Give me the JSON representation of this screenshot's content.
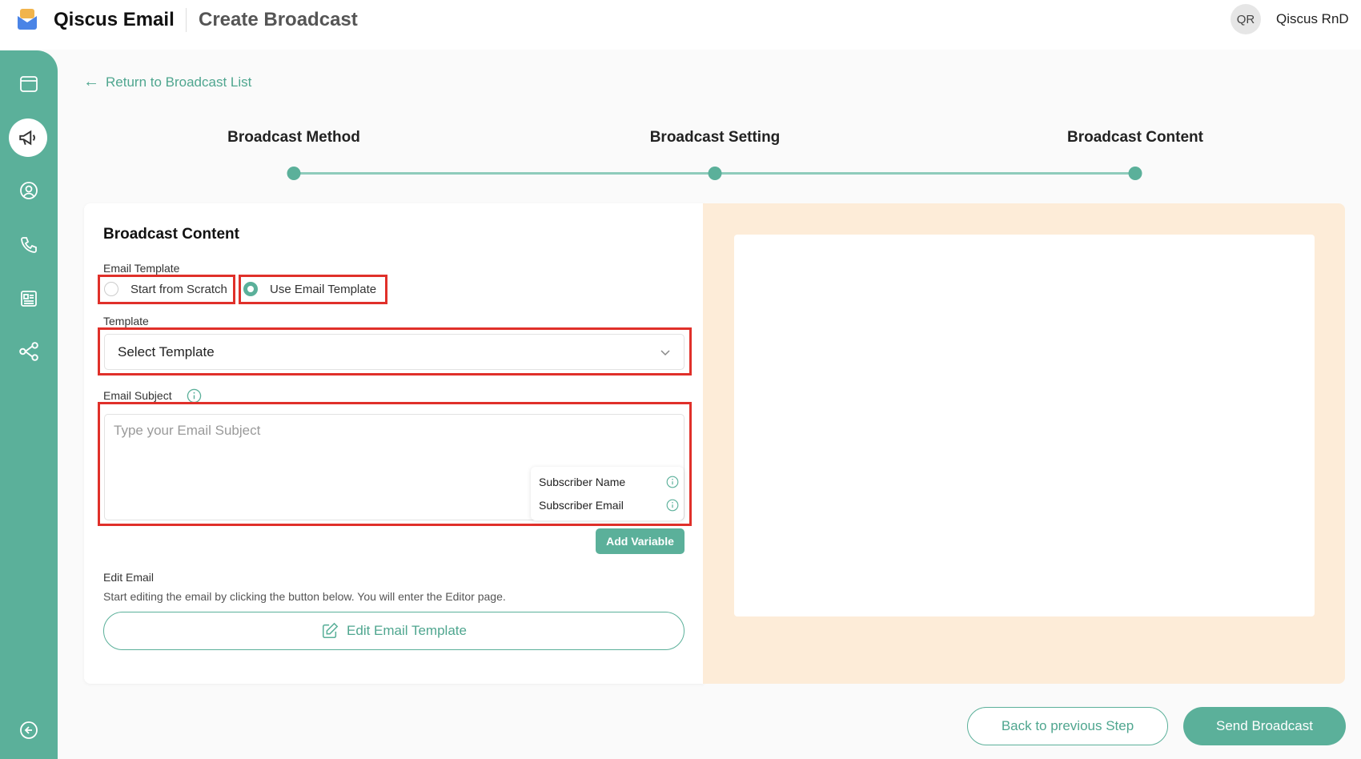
{
  "header": {
    "app_name": "Qiscus Email",
    "page_title": "Create Broadcast",
    "avatar_initials": "QR",
    "user_name": "Qiscus RnD"
  },
  "sidebar": {
    "items": [
      "dashboard-icon",
      "broadcast-icon",
      "contacts-icon",
      "phone-icon",
      "news-icon",
      "integration-icon"
    ],
    "collapse": "collapse-icon"
  },
  "nav": {
    "back_link": "Return to Broadcast List"
  },
  "steps": [
    "Broadcast Method",
    "Broadcast Setting",
    "Broadcast Content"
  ],
  "form": {
    "title": "Broadcast Content",
    "email_template_label": "Email Template",
    "option_scratch": "Start from Scratch",
    "option_template": "Use Email Template",
    "template_label": "Template",
    "template_select": "Select Template",
    "subject_label": "Email Subject",
    "subject_placeholder": "Type your Email Subject",
    "variables": [
      "Subscriber Name",
      "Subscriber Email"
    ],
    "add_variable": "Add Variable",
    "edit_label": "Edit Email",
    "edit_desc": "Start editing the email by clicking the button below. You will enter the Editor page.",
    "edit_button": "Edit Email Template"
  },
  "footer": {
    "back": "Back to previous Step",
    "send": "Send Broadcast"
  },
  "colors": {
    "accent": "#5bb09a",
    "preview_bg": "#fdecd8",
    "highlight": "#e0302a"
  }
}
